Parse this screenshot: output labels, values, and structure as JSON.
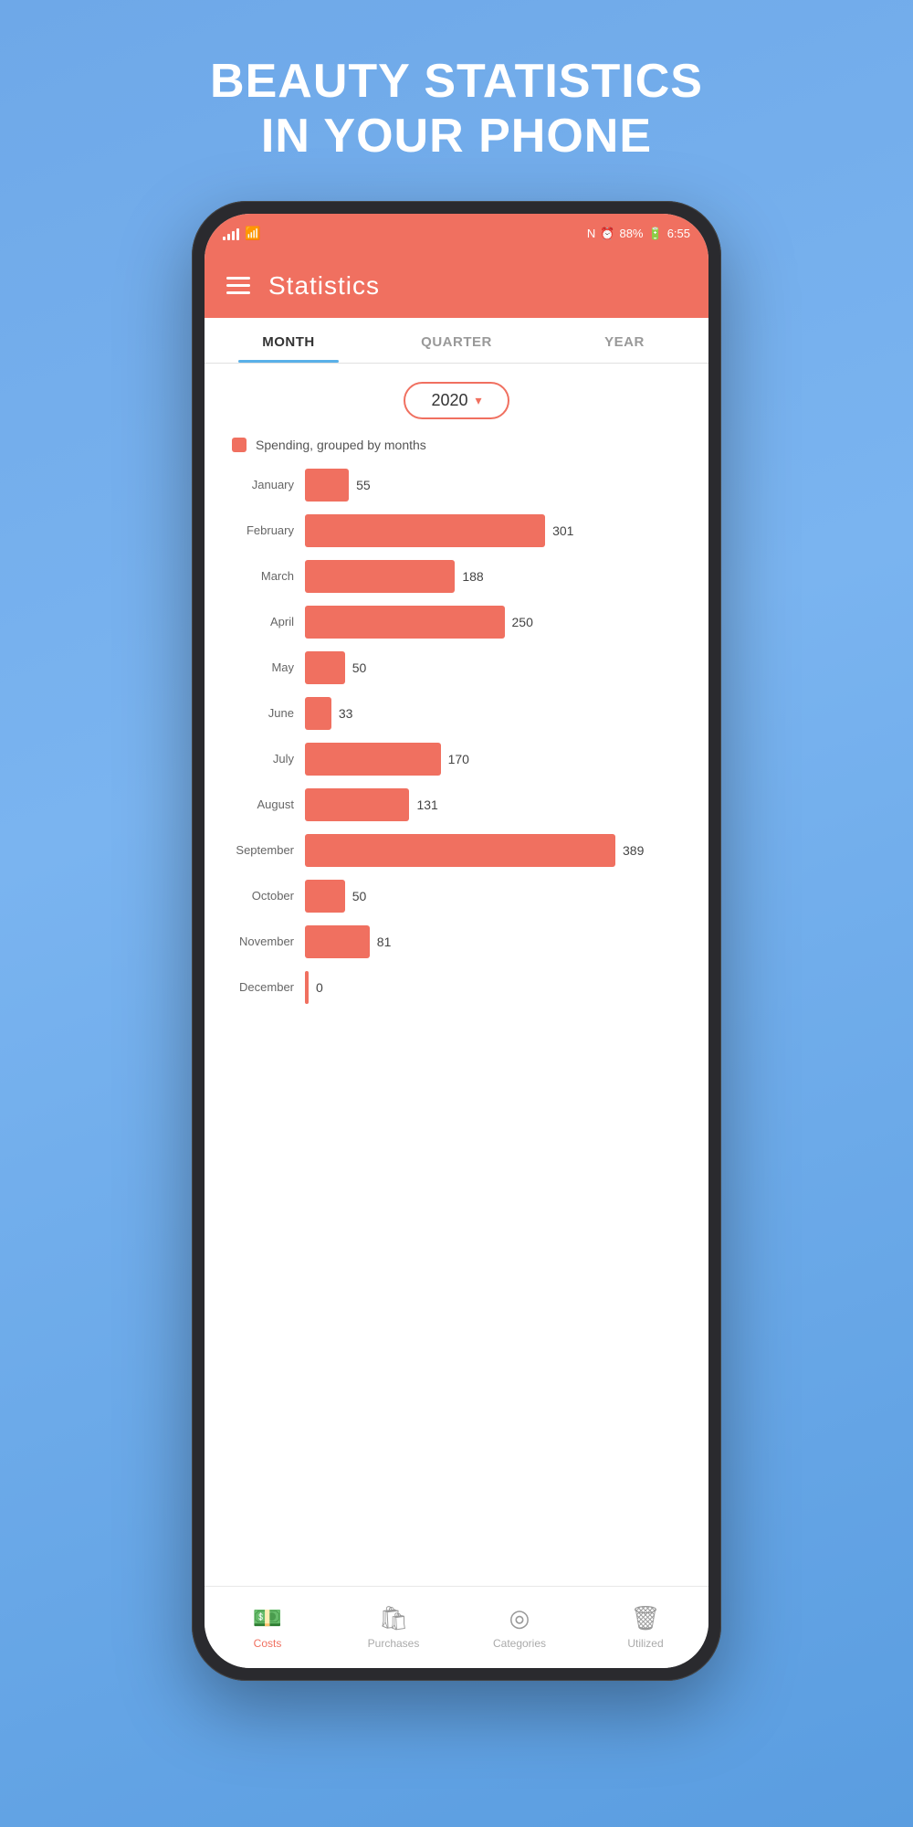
{
  "hero": {
    "line1": "BEAUTY STATISTICS",
    "line2": "IN YOUR PHONE"
  },
  "status_bar": {
    "battery": "88%",
    "time": "6:55"
  },
  "app": {
    "title": "Statistics"
  },
  "tabs": [
    {
      "id": "month",
      "label": "MONTH",
      "active": true
    },
    {
      "id": "quarter",
      "label": "QUARTER",
      "active": false
    },
    {
      "id": "year",
      "label": "YEAR",
      "active": false
    }
  ],
  "year_selector": {
    "value": "2020",
    "chevron": "▾"
  },
  "chart": {
    "legend": "Spending, grouped by months",
    "max_value": 389,
    "bars": [
      {
        "month": "January",
        "value": 55
      },
      {
        "month": "February",
        "value": 301
      },
      {
        "month": "March",
        "value": 188
      },
      {
        "month": "April",
        "value": 250
      },
      {
        "month": "May",
        "value": 50
      },
      {
        "month": "June",
        "value": 33
      },
      {
        "month": "July",
        "value": 170
      },
      {
        "month": "August",
        "value": 131
      },
      {
        "month": "September",
        "value": 389
      },
      {
        "month": "October",
        "value": 50
      },
      {
        "month": "November",
        "value": 81
      },
      {
        "month": "December",
        "value": 0
      }
    ]
  },
  "bottom_nav": [
    {
      "id": "costs",
      "label": "Costs",
      "icon": "💵",
      "active": true
    },
    {
      "id": "purchases",
      "label": "Purchases",
      "icon": "🛍",
      "active": false
    },
    {
      "id": "categories",
      "label": "Categories",
      "icon": "◎",
      "active": false
    },
    {
      "id": "utilized",
      "label": "Utilized",
      "icon": "🗑",
      "active": false
    }
  ]
}
